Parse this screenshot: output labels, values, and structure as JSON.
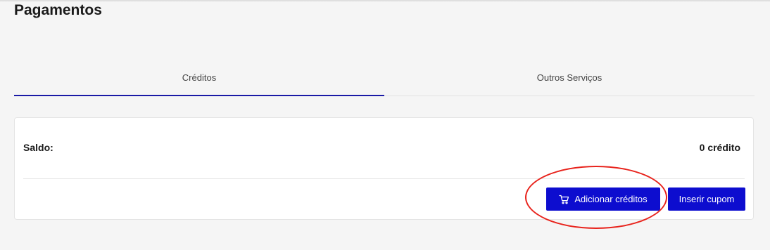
{
  "page": {
    "title": "Pagamentos"
  },
  "tabs": [
    {
      "label": "Créditos",
      "active": true
    },
    {
      "label": "Outros Serviços",
      "active": false
    }
  ],
  "balance": {
    "label": "Saldo:",
    "value": "0 crédito"
  },
  "actions": {
    "add_credits_label": "Adicionar créditos",
    "add_credits_icon": "cart-icon",
    "insert_coupon_label": "Inserir cupom"
  },
  "colors": {
    "primary": "#0d0dcf",
    "tab_indicator": "#1a1aa6",
    "annotation": "#e8231c",
    "background": "#f5f5f5"
  }
}
